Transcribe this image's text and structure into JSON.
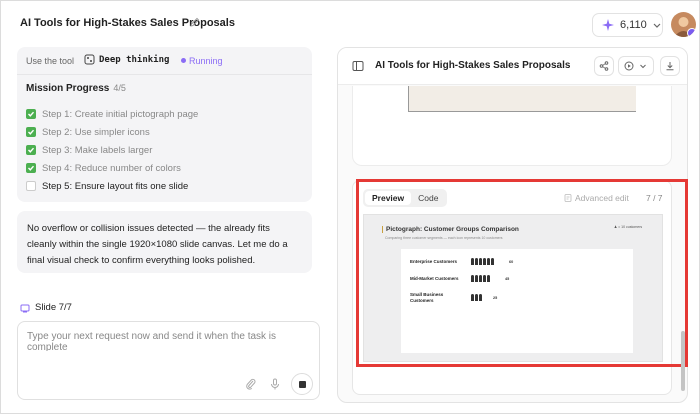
{
  "header": {
    "title": "AI Tools for High-Stakes Sales Proposals",
    "credits": "6,110"
  },
  "task": {
    "use_tool_label": "Use the tool",
    "tool_name": "Deep thinking",
    "status": "Running",
    "progress_title": "Mission Progress",
    "progress_count": "4/5",
    "steps": [
      {
        "label": "Step 1: Create initial pictograph page",
        "done": true
      },
      {
        "label": "Step 2: Use simpler icons",
        "done": true
      },
      {
        "label": "Step 3: Make labels larger",
        "done": true
      },
      {
        "label": "Step 4: Reduce number of colors",
        "done": true
      },
      {
        "label": "Step 5: Ensure layout fits one slide",
        "done": false
      }
    ]
  },
  "message": "No overflow or collision issues detected — the already fits cleanly within the single 1920×1080 slide canvas. Let me do a final visual check to confirm everything looks polished.",
  "slide_label": "Slide 7/7",
  "input": {
    "placeholder": "Type your next request now and send it when the task is complete"
  },
  "preview_panel": {
    "title": "AI Tools for High-Stakes Sales Proposals",
    "tabs": [
      "Preview",
      "Code"
    ],
    "active_tab": "Preview",
    "advanced_edit": "Advanced edit",
    "page": "7 / 7"
  },
  "slide": {
    "title": "Pictograph: Customer Groups Comparison",
    "subtitle": "Comparing three customer segments — each icon represents 10 customers",
    "key": "= 10 customers",
    "rows": [
      {
        "label": "Enterprise Customers",
        "icons": 6,
        "value": "60"
      },
      {
        "label": "Mid-Market Customers",
        "icons": 5,
        "value": "45"
      },
      {
        "label": "Small Business Customers",
        "icons": 3,
        "value": "25"
      }
    ]
  },
  "colors": {
    "accent": "#8b6cf5",
    "check": "#4caf50",
    "highlight": "#e53935"
  }
}
